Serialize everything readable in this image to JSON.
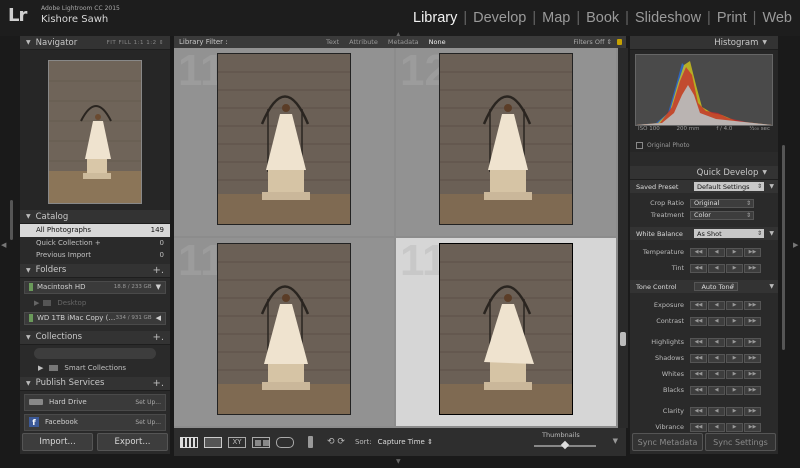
{
  "app": {
    "logo": "Lr",
    "name": "Adobe Lightroom CC 2015",
    "user": "Kishore Sawh"
  },
  "modules": [
    {
      "label": "Library",
      "active": true
    },
    {
      "label": "Develop",
      "active": false
    },
    {
      "label": "Map",
      "active": false
    },
    {
      "label": "Book",
      "active": false
    },
    {
      "label": "Slideshow",
      "active": false
    },
    {
      "label": "Print",
      "active": false
    },
    {
      "label": "Web",
      "active": false
    }
  ],
  "navigator": {
    "title": "Navigator",
    "zoom_options": "FIT   FILL   1:1   1:2  ⇕"
  },
  "catalog": {
    "title": "Catalog",
    "items": [
      {
        "label": "All Photographs",
        "count": "149"
      },
      {
        "label": "Quick Collection +",
        "count": "0"
      },
      {
        "label": "Previous Import",
        "count": "0"
      }
    ]
  },
  "folders": {
    "title": "Folders",
    "add": "+.",
    "drives": [
      {
        "label": "Macintosh HD",
        "capacity": "18.8 / 233 GB"
      },
      {
        "label": "WD 1TB iMac Copy (…",
        "capacity": "334 / 931 GB"
      }
    ],
    "sub": "Desktop"
  },
  "collections": {
    "title": "Collections",
    "add": "+.",
    "items": [
      {
        "label": "Smart Collections"
      }
    ]
  },
  "publish": {
    "title": "Publish Services",
    "add": "+.",
    "items": [
      {
        "label": "Hard Drive",
        "action": "Set Up..."
      },
      {
        "label": "Facebook",
        "action": "Set Up..."
      }
    ]
  },
  "left_buttons": {
    "import": "Import...",
    "export": "Export..."
  },
  "filter_bar": {
    "label": "Library Filter :",
    "options": [
      "Text",
      "Attribute",
      "Metadata",
      "None"
    ],
    "active": "None",
    "status": "Filters Off ⇕"
  },
  "grid": {
    "cells": [
      {
        "num": "11",
        "selected": false
      },
      {
        "num": "12",
        "selected": false
      },
      {
        "num": "11",
        "selected": false
      },
      {
        "num": "110",
        "selected": true
      }
    ]
  },
  "toolbar": {
    "sort_label": "Sort:",
    "sort_value": "Capture Time  ⇕",
    "thumbnails_label": "Thumbnails",
    "thumbnail_level": 0.5,
    "icons": [
      "grid-view-icon",
      "loupe-view-icon",
      "compare-view-icon",
      "survey-view-icon",
      "people-view-icon",
      "spray-can-icon",
      "rotate-icon"
    ]
  },
  "histogram": {
    "title": "Histogram",
    "iso": "ISO 100",
    "focal": "200 mm",
    "aperture": "f / 4.0",
    "shutter": "¹⁄₂₀₀ sec",
    "original_photo": "Original Photo"
  },
  "quick_develop": {
    "title": "Quick Develop",
    "saved_preset_label": "Saved Preset",
    "saved_preset_value": "Default Settings",
    "crop_ratio_label": "Crop Ratio",
    "crop_ratio_value": "Original",
    "treatment_label": "Treatment",
    "treatment_value": "Color",
    "white_balance_label": "White Balance",
    "white_balance_value": "As Shot",
    "temperature_label": "Temperature",
    "tint_label": "Tint",
    "tone_control_label": "Tone Control",
    "auto_tone_label": "Auto Tone",
    "exposure_label": "Exposure",
    "contrast_label": "Contrast",
    "highlights_label": "Highlights",
    "shadows_label": "Shadows",
    "whites_label": "Whites",
    "blacks_label": "Blacks",
    "clarity_label": "Clarity",
    "vibrance_label": "Vibrance"
  },
  "right_buttons": {
    "sync_metadata": "Sync Metadata",
    "sync_settings": "Sync Settings"
  }
}
